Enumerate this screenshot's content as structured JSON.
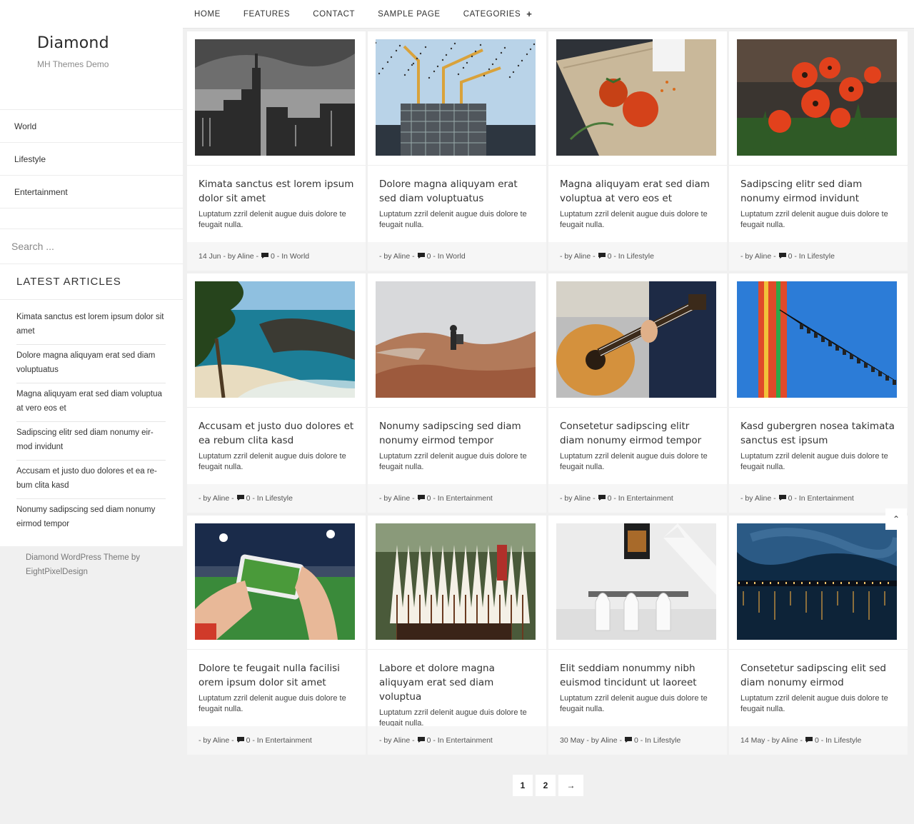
{
  "site": {
    "title": "Diamond",
    "tagline": "MH Themes Demo"
  },
  "sidebar": {
    "nav": [
      "World",
      "Lifestyle",
      "Entertainment"
    ],
    "search_placeholder": "Search ...",
    "latest_heading": "LATEST ARTICLES",
    "latest": [
      "Kimata sanctus est lorem ipsum dolor sit amet",
      "Dolore magna aliquyam erat sed diam voluptuatus",
      "Magna aliquyam erat sed diam voluptua at vero eos et",
      "Sadipscing elitr sed diam nonumy eir-mod invidunt",
      "Accusam et justo duo dolores et ea re-bum clita kasd",
      "Nonumy sadipscing sed diam nonumy eirmod tempor"
    ],
    "credit": "Diamond WordPress Theme by EightPixelDesign"
  },
  "topnav": {
    "items": [
      "HOME",
      "FEATURES",
      "CONTACT",
      "SAMPLE PAGE",
      "CATEGORIES"
    ],
    "plus": "+"
  },
  "posts": [
    {
      "title": "Kimata sanctus est lorem ipsum dolor sit amet",
      "excerpt": "Luptatum zzril delenit augue duis dolore te feugait nulla.",
      "meta": "14 Jun - by Aline -",
      "comments": "0 - In World",
      "image": "city-skyline-bw"
    },
    {
      "title": "Dolore magna aliquyam erat sed diam voluptuatus",
      "excerpt": "Luptatum zzril delenit augue duis dolore te feugait nulla.",
      "meta": "- by Aline -",
      "comments": "0 - In World",
      "image": "construction-cranes"
    },
    {
      "title": "Magna aliquyam erat sed diam voluptua at vero eos et",
      "excerpt": "Luptatum zzril delenit augue duis dolore te feugait nulla.",
      "meta": "- by Aline -",
      "comments": "0 - In Lifestyle",
      "image": "tomatoes-board"
    },
    {
      "title": "Sadipscing elitr sed diam nonumy eirmod invidunt",
      "excerpt": "Luptatum zzril delenit augue duis dolore te feugait nulla.",
      "meta": "- by Aline -",
      "comments": "0 - In Lifestyle",
      "image": "red-poppies"
    },
    {
      "title": "Accusam et justo duo dolores et ea rebum clita kasd",
      "excerpt": "Luptatum zzril delenit augue duis dolore te feugait nulla.",
      "meta": "- by Aline -",
      "comments": "0 - In Lifestyle",
      "image": "coast-waterfall"
    },
    {
      "title": "Nonumy sadipscing sed diam nonumy eirmod tempor",
      "excerpt": "Luptatum zzril delenit augue duis dolore te feugait nulla.",
      "meta": "- by Aline -",
      "comments": "0 - In Entertainment",
      "image": "hiker-canyon"
    },
    {
      "title": "Consetetur sadipscing elitr diam nonumy eirmod tempor",
      "excerpt": "Luptatum zzril delenit augue duis dolore te feugait nulla.",
      "meta": "- by Aline -",
      "comments": "0 - In Entertainment",
      "image": "acoustic-guitar"
    },
    {
      "title": "Kasd gubergren nosea takimata sanctus est ipsum",
      "excerpt": "Luptatum zzril delenit augue duis dolore te feugait nulla.",
      "meta": "- by Aline -",
      "comments": "0 - In Entertainment",
      "image": "swing-carousel"
    },
    {
      "title": "Dolore te feugait nulla facilisi orem ipsum dolor sit amet",
      "excerpt": "Luptatum zzril delenit augue duis dolore te feugait nulla.",
      "meta": "- by Aline -",
      "comments": "0 - In Entertainment",
      "image": "phone-stadium"
    },
    {
      "title": "Labore et dolore magna aliquyam erat sed diam voluptua",
      "excerpt": "Luptatum zzril delenit augue duis dolore te feugait nulla.",
      "meta": "- by Aline -",
      "comments": "0 - In Entertainment",
      "image": "arrows-quiver"
    },
    {
      "title": "Elit seddiam nonummy nibh euismod tincidunt ut laoreet",
      "excerpt": "Luptatum zzril delenit augue duis dolore te feugait nulla.",
      "meta": "30 May - by Aline -",
      "comments": "0 - In Lifestyle",
      "image": "white-dining-room"
    },
    {
      "title": "Consetetur sadipscing elit sed diam nonumy eirmod",
      "excerpt": "Luptatum zzril delenit augue duis dolore te feugait nulla.",
      "meta": "14 May - by Aline -",
      "comments": "0 - In Lifestyle",
      "image": "night-harbor"
    }
  ],
  "pagination": {
    "pages": [
      "1",
      "2"
    ],
    "next": "→"
  },
  "back_to_top": "⌃"
}
